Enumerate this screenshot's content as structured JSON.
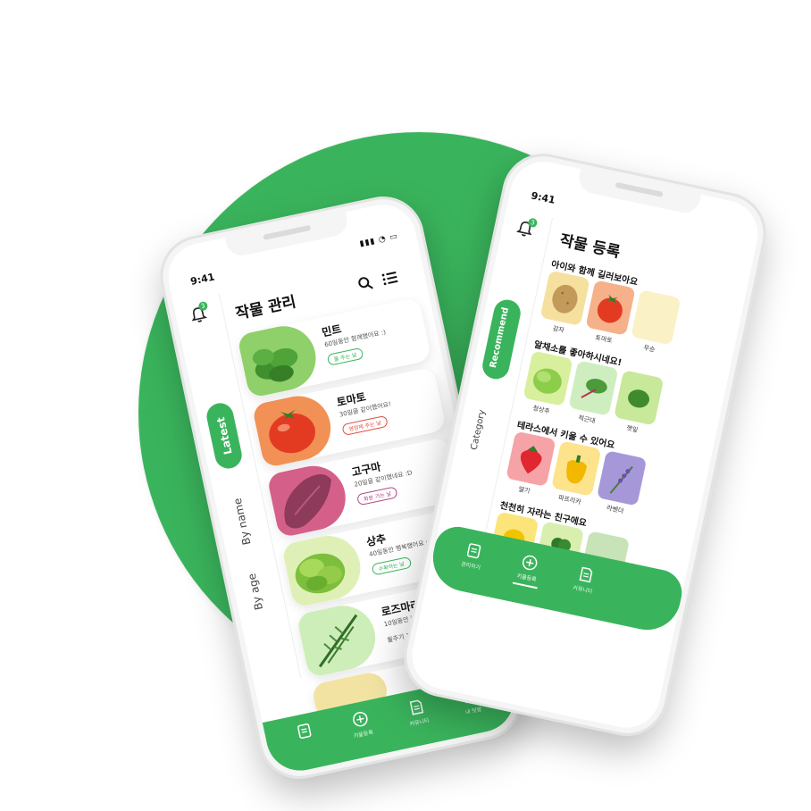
{
  "colors": {
    "brand_green": "#3ab45c",
    "background": "#ffffff"
  },
  "left_phone": {
    "status_time": "9:41",
    "notification_count": "3",
    "title": "작물 관리",
    "icons": {
      "search": "search-icon",
      "filter": "list-filter-icon",
      "bell": "bell-icon"
    },
    "rail": {
      "active": "Latest",
      "by_name": "By name",
      "by_age": "By age"
    },
    "crops": [
      {
        "name": "민트",
        "desc": "60일동안 함께했어요 :)",
        "tag": "물 주는 날",
        "tag_style": "green",
        "color": "#8fd06b"
      },
      {
        "name": "토마토",
        "desc": "30일을 같이했어요!",
        "tag": "영양제 주는 날",
        "tag_style": "red",
        "color": "#f29155"
      },
      {
        "name": "고구마",
        "desc": "20일을 같이했네요 :D",
        "tag": "화분 가는 날",
        "tag_style": "purple",
        "color": "#d4608a"
      },
      {
        "name": "상추",
        "desc": "40일동안 행복했어요 :)",
        "tag": "수확하는 날",
        "tag_style": "green",
        "color": "#dff0b6"
      },
      {
        "name": "로즈마리",
        "desc": "10일동안 함께해",
        "tag": "물주기 1일 전",
        "tag_style": "plain",
        "color": "#cdeeb8"
      }
    ],
    "tabs": [
      {
        "label": "",
        "icon": "journal-icon"
      },
      {
        "label": "키울등록",
        "icon": "plus-circle-icon"
      },
      {
        "label": "커뮤니티",
        "icon": "document-icon"
      },
      {
        "label": "내 텃밭",
        "icon": "person-icon"
      }
    ]
  },
  "right_phone": {
    "status_time": "9:41",
    "notification_count": "3",
    "title": "작물 등록",
    "rail": {
      "active": "Recommend",
      "other": "Category"
    },
    "sections": [
      {
        "title": "아이와 함께 길러보아요",
        "items": [
          {
            "label": "감자",
            "color": "#f5e0a0"
          },
          {
            "label": "토마토",
            "color": "#f6b08a"
          },
          {
            "label": "무순",
            "color": "#fbf1c6"
          }
        ]
      },
      {
        "title": "알채소를 좋아하시네요!",
        "items": [
          {
            "label": "청상추",
            "color": "#d8ef9e"
          },
          {
            "label": "적근대",
            "color": "#cfeec0"
          },
          {
            "label": "깻잎",
            "color": "#c8e89a"
          }
        ]
      },
      {
        "title": "테라스에서 키울 수 있어요",
        "items": [
          {
            "label": "딸기",
            "color": "#f6a3a8"
          },
          {
            "label": "파프리카",
            "color": "#fce38c"
          },
          {
            "label": "라벤더",
            "color": "#a698d8"
          }
        ]
      },
      {
        "title": "천천히 자라는 친구에요",
        "items": [
          {
            "label": "",
            "color": "#fbe57a"
          },
          {
            "label": "",
            "color": "#d9efb0"
          },
          {
            "label": "",
            "color": "#c8e3b8"
          }
        ]
      }
    ],
    "tabs": [
      {
        "label": "관리하기",
        "icon": "journal-icon"
      },
      {
        "label": "키울등록",
        "icon": "plus-circle-icon"
      },
      {
        "label": "커뮤니티",
        "icon": "document-icon"
      }
    ]
  }
}
